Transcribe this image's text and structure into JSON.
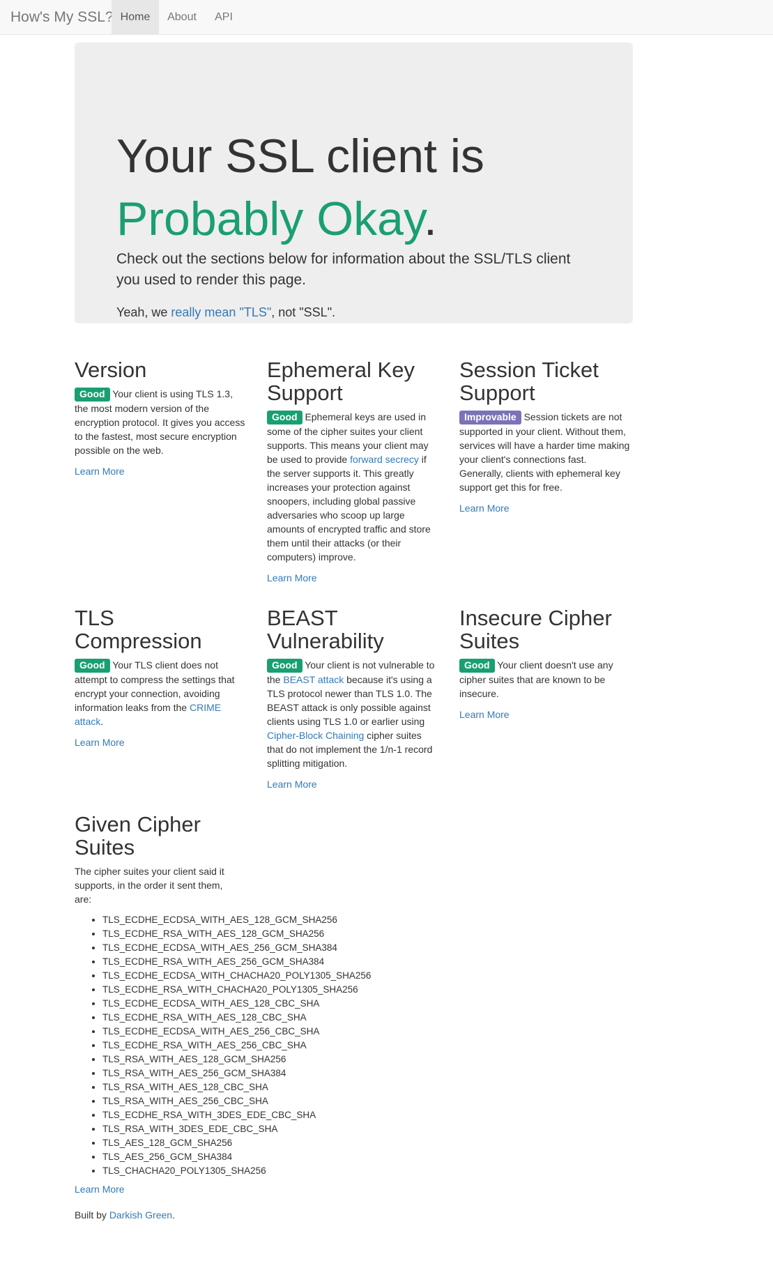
{
  "nav": {
    "brand": "How's My SSL?",
    "items": [
      {
        "label": "Home",
        "active": true
      },
      {
        "label": "About",
        "active": false
      },
      {
        "label": "API",
        "active": false
      }
    ]
  },
  "hero": {
    "line1": "Your SSL client is",
    "rating": "Probably Okay",
    "rating_suffix": ".",
    "lead": "Check out the sections below for information about the SSL/TLS client you used to render this page.",
    "note_prefix": "Yeah, we ",
    "note_link": "really mean \"TLS\"",
    "note_suffix": ", not \"SSL\"."
  },
  "colors": {
    "good": "#1a9f72",
    "improvable": "#7a73b8",
    "link": "#337ab7"
  },
  "learn_more": "Learn More",
  "sections": {
    "version": {
      "title": "Version",
      "label": "Good",
      "text": "Your client is using TLS 1.3, the most modern version of the encryption protocol. It gives you access to the fastest, most secure encryption possible on the web."
    },
    "ephemeral": {
      "title": "Ephemeral Key Support",
      "label": "Good",
      "text_before": "Ephemeral keys are used in some of the cipher suites your client supports. This means your client may be used to provide ",
      "link": "forward secrecy",
      "text_after": " if the server supports it. This greatly increases your protection against snoopers, including global passive adversaries who scoop up large amounts of encrypted traffic and store them until their attacks (or their computers) improve."
    },
    "session": {
      "title": "Session Ticket Support",
      "label": "Improvable",
      "text": "Session tickets are not supported in your client. Without them, services will have a harder time making your client's connections fast. Generally, clients with ephemeral key support get this for free."
    },
    "compression": {
      "title": "TLS Compression",
      "label": "Good",
      "text_before": "Your TLS client does not attempt to compress the settings that encrypt your connection, avoiding information leaks from the ",
      "link": "CRIME attack",
      "text_after": "."
    },
    "beast": {
      "title": "BEAST Vulnerability",
      "label": "Good",
      "text_before": "Your client is not vulnerable to the ",
      "link1": "BEAST attack",
      "text_middle": " because it's using a TLS protocol newer than TLS 1.0. The BEAST attack is only possible against clients using TLS 1.0 or earlier using ",
      "link2": "Cipher-Block Chaining",
      "text_after": " cipher suites that do not implement the 1/n-1 record splitting mitigation."
    },
    "insecure": {
      "title": "Insecure Cipher Suites",
      "label": "Good",
      "text": "Your client doesn't use any cipher suites that are known to be insecure."
    },
    "given": {
      "title": "Given Cipher Suites",
      "text": "The cipher suites your client said it supports, in the order it sent them, are:",
      "ciphers": [
        "TLS_ECDHE_ECDSA_WITH_AES_128_GCM_SHA256",
        "TLS_ECDHE_RSA_WITH_AES_128_GCM_SHA256",
        "TLS_ECDHE_ECDSA_WITH_AES_256_GCM_SHA384",
        "TLS_ECDHE_RSA_WITH_AES_256_GCM_SHA384",
        "TLS_ECDHE_ECDSA_WITH_CHACHA20_POLY1305_SHA256",
        "TLS_ECDHE_RSA_WITH_CHACHA20_POLY1305_SHA256",
        "TLS_ECDHE_ECDSA_WITH_AES_128_CBC_SHA",
        "TLS_ECDHE_RSA_WITH_AES_128_CBC_SHA",
        "TLS_ECDHE_ECDSA_WITH_AES_256_CBC_SHA",
        "TLS_ECDHE_RSA_WITH_AES_256_CBC_SHA",
        "TLS_RSA_WITH_AES_128_GCM_SHA256",
        "TLS_RSA_WITH_AES_256_GCM_SHA384",
        "TLS_RSA_WITH_AES_128_CBC_SHA",
        "TLS_RSA_WITH_AES_256_CBC_SHA",
        "TLS_ECDHE_RSA_WITH_3DES_EDE_CBC_SHA",
        "TLS_RSA_WITH_3DES_EDE_CBC_SHA",
        "TLS_AES_128_GCM_SHA256",
        "TLS_AES_256_GCM_SHA384",
        "TLS_CHACHA20_POLY1305_SHA256"
      ]
    }
  },
  "footer": {
    "prefix": "Built by ",
    "link": "Darkish Green",
    "suffix": "."
  }
}
